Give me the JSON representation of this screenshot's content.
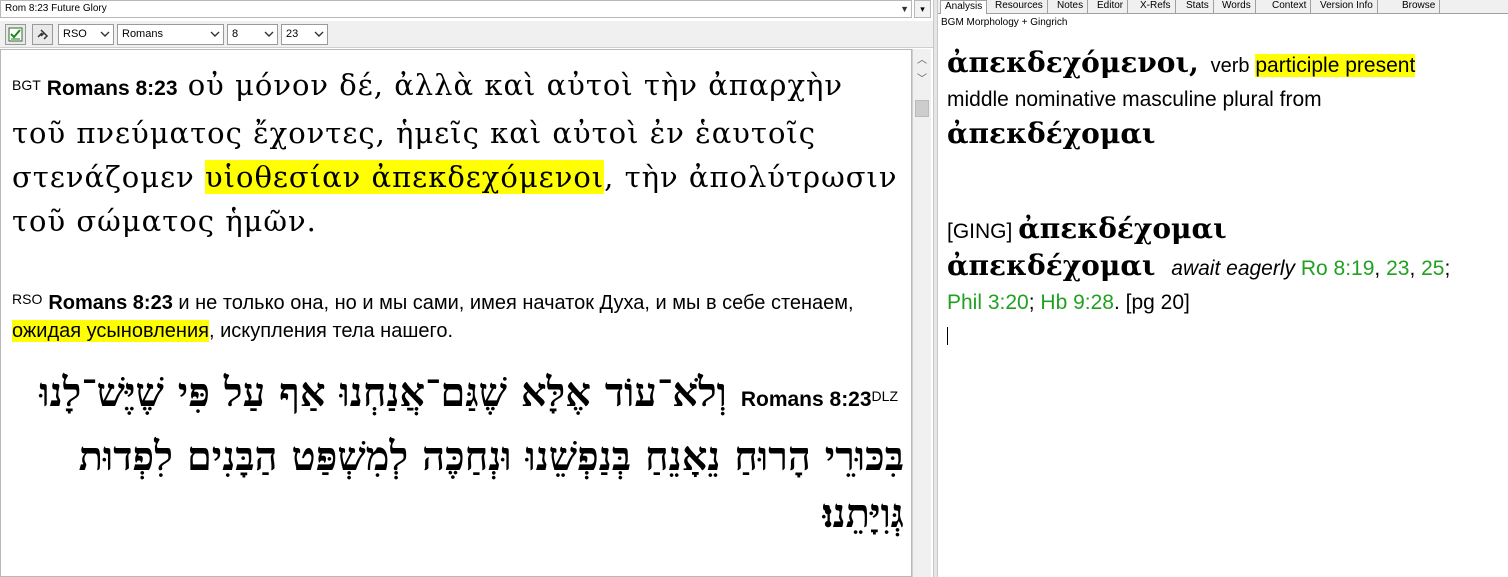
{
  "window": {
    "verse_selector": "Rom 8:23 Future Glory"
  },
  "toolbar": {
    "version_combo": "RSO",
    "book_combo": "Romans",
    "chapter_combo": "8",
    "verse_combo": "23"
  },
  "bgt": {
    "version": "BGT",
    "ref": "Romans 8:23",
    "text_before": "οὐ μόνον δέ, ἀλλὰ καὶ αὐτοὶ τὴν ἀπαρχὴν τοῦ πνεύματος ἔχοντες, ἡμεῖς καὶ αὐτοὶ ἐν ἑαυτοῖς στενάζομεν ",
    "highlight": "υἱοθεσίαν ἀπεκδεχόμενοι",
    "text_after": ", τὴν ἀπολύτρωσιν τοῦ σώματος ἡμῶν."
  },
  "rso": {
    "version": "RSO",
    "ref": "Romans 8:23",
    "text_before": "и не только она, но и мы сами, имея начаток Духа, и мы в себе стенаем, ",
    "highlight": "ожидая усыновления",
    "text_after": ", искупления тела нашего."
  },
  "dlz": {
    "version": "DLZ",
    "ref": "Romans 8:23",
    "text": "וְלֹא־עוֹד אֶלָּא שֶׁגַּם־אֲנַחְנוּ אַף עַל פִּי שֶׁיֶּשׁ־לָנוּ בִּכּוּרֵי הָרוּחַ נֵאָנֵחַ בְּנַפְשֵׁנוּ וּנְחַכֶּה לְמִשְׁפַּט הַבָּנִים לִפְדוּת גְּוִיָּתֵנוּ׃"
  },
  "tabs": [
    "Analysis",
    "Resources",
    "Notes",
    "Editor",
    "X-Refs",
    "Stats",
    "Words",
    "Context",
    "Version Info",
    "Browse"
  ],
  "analysis": {
    "subtitle": "BGM Morphology + Gingrich",
    "word": "ἀπεκδεχόμενοι,",
    "pos": "verb",
    "parse_highlight": "participle present",
    "parse_rest": "middle nominative masculine plural from",
    "lemma": "ἀπεκδέχομαι",
    "ging_tag": "[GING]",
    "ging_lemma": "ἀπεκδέχομαι",
    "entry_lemma": "ἀπεκδέχομαι",
    "gloss": "await eagerly",
    "refs": [
      "Ro 8:19",
      "23",
      "25",
      "Phil 3:20",
      "Hb 9:28"
    ],
    "page": "[pg 20]"
  }
}
